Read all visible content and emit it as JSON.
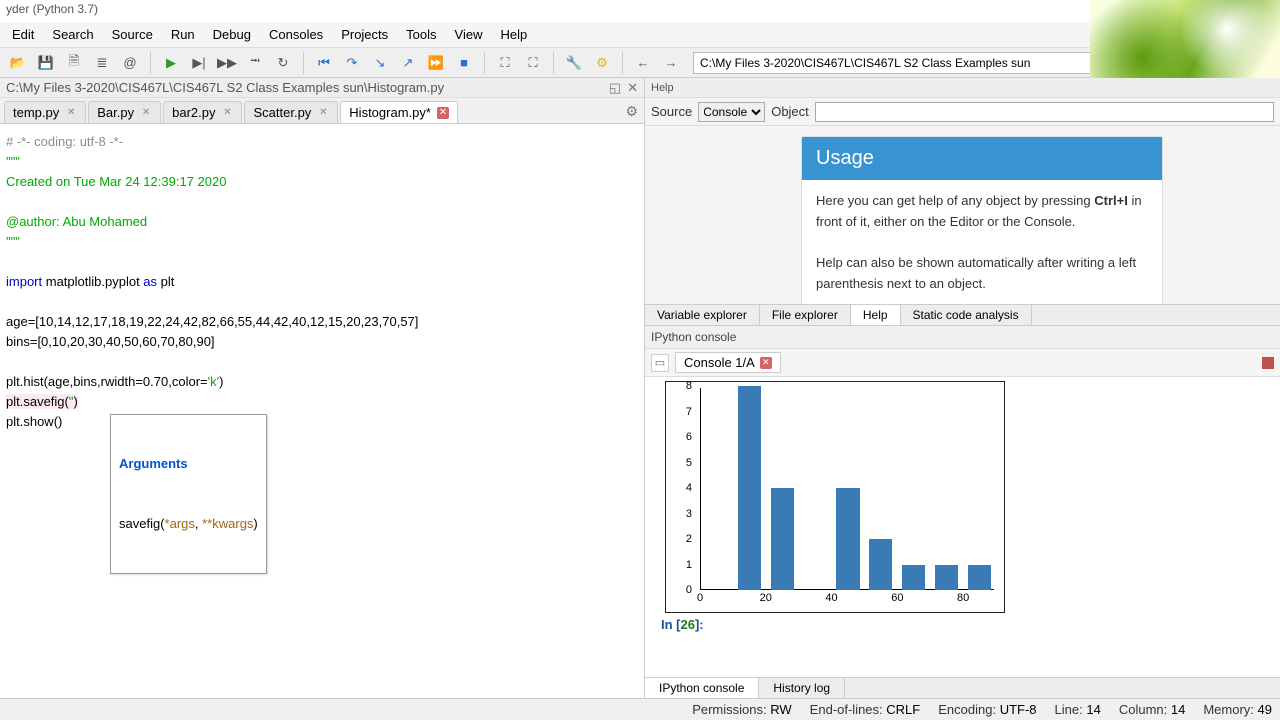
{
  "window_title": "yder (Python 3.7)",
  "menu": [
    "Edit",
    "Search",
    "Source",
    "Run",
    "Debug",
    "Consoles",
    "Projects",
    "Tools",
    "View",
    "Help"
  ],
  "toolbar_path": "C:\\My Files 3-2020\\CIS467L\\CIS467L S2 Class Examples sun",
  "editor_path": "C:\\My Files 3-2020\\CIS467L\\CIS467L S2 Class Examples sun\\Histogram.py",
  "tabs": [
    {
      "label": "temp.py",
      "dirty": false
    },
    {
      "label": "Bar.py",
      "dirty": false
    },
    {
      "label": "bar2.py",
      "dirty": false
    },
    {
      "label": "Scatter.py",
      "dirty": false
    },
    {
      "label": "Histogram.py*",
      "dirty": true,
      "active": true
    }
  ],
  "code": {
    "l1": "# -*- coding: utf-8 -*-",
    "l2": "\"\"\"",
    "l3": "Created on Tue Mar 24 12:39:17 2020",
    "l4": "",
    "l5": "@author: Abu Mohamed",
    "l6": "\"\"\"",
    "l7": "",
    "l8_kw": "import",
    "l8_rest": " matplotlib.pyplot ",
    "l8_kw2": "as",
    "l8_rest2": " plt",
    "l9": "",
    "l10": "age=[10,14,12,17,18,19,22,24,42,82,66,55,44,42,40,12,15,20,23,70,57]",
    "l11": "bins=[0,10,20,30,40,50,60,70,80,90]",
    "l12": "",
    "l13a": "plt.hist(age,bins,rwidth=0.70,color=",
    "l13b": "'k'",
    "l13c": ")",
    "l14a": "plt.savefig(",
    "l14b": "\"",
    "l14c": ")",
    "l15": "plt.show()"
  },
  "tooltip": {
    "title": "Arguments",
    "sig_pre": "savefig(",
    "args": "*args",
    "comma": ", ",
    "kwargs": "**kwargs",
    "sig_post": ")"
  },
  "help_pane": {
    "title": "Help",
    "source_label": "Source",
    "source_value": "Console",
    "object_label": "Object",
    "card_title": "Usage",
    "card_body_1": "Here you can get help of any object by pressing ",
    "card_body_kbd": "Ctrl+I",
    "card_body_2": " in front of it, either on the Editor or the Console.",
    "card_body_3": "Help can also be shown automatically after writing a left parenthesis next to an object."
  },
  "mid_tabs": [
    "Variable explorer",
    "File explorer",
    "Help",
    "Static code analysis"
  ],
  "console": {
    "section_label": "IPython console",
    "tab_label": "Console 1/A",
    "prompt_in": "In [",
    "prompt_num": "26",
    "prompt_close": "]:"
  },
  "bottom_tabs": [
    "IPython console",
    "History log"
  ],
  "status": {
    "perm_label": "Permissions:",
    "perm_val": "RW",
    "eol_label": "End-of-lines:",
    "eol_val": "CRLF",
    "enc_label": "Encoding:",
    "enc_val": "UTF-8",
    "line_label": "Line:",
    "line_val": "14",
    "col_label": "Column:",
    "col_val": "14",
    "mem_label": "Memory:",
    "mem_val": "49"
  },
  "chart_data": {
    "type": "bar",
    "title": "",
    "xlabel": "",
    "ylabel": "",
    "bins": [
      0,
      10,
      20,
      30,
      40,
      50,
      60,
      70,
      80,
      90
    ],
    "counts": [
      0,
      8,
      4,
      0,
      4,
      2,
      1,
      1,
      1
    ],
    "y_ticks": [
      0,
      1,
      2,
      3,
      4,
      5,
      6,
      7,
      8
    ],
    "x_ticks": [
      0,
      20,
      40,
      60,
      80
    ],
    "ylim": [
      0,
      8
    ],
    "xlim": [
      0,
      90
    ],
    "bar_color": "#3a7ab5",
    "rwidth": 0.7
  }
}
